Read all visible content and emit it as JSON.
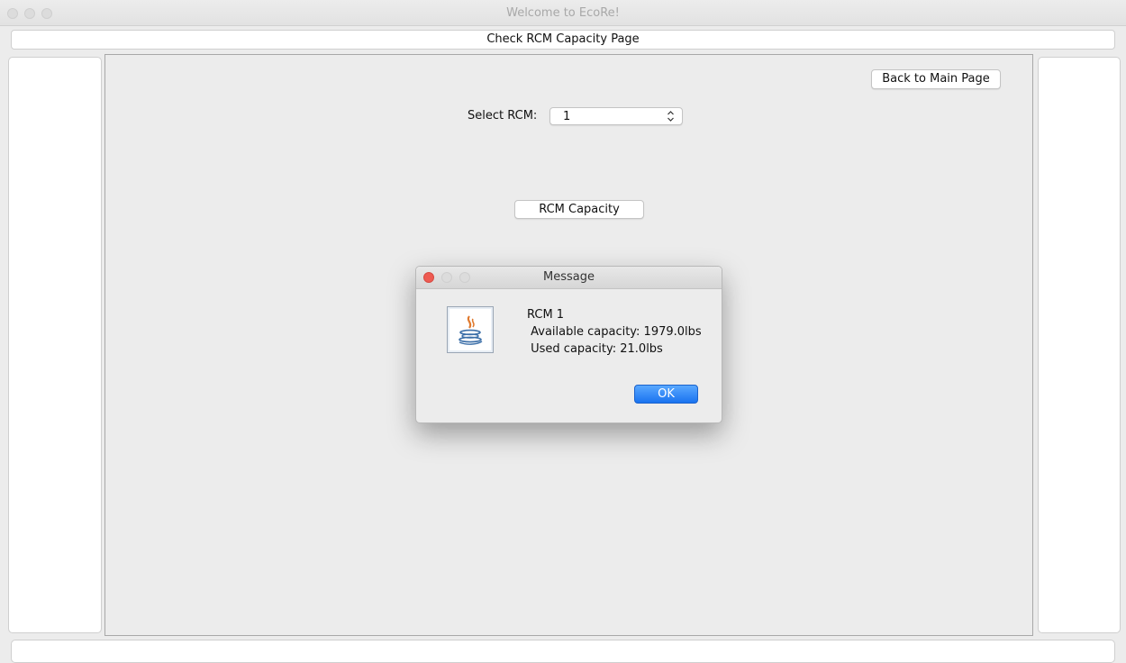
{
  "window": {
    "title": "Welcome to EcoRe!"
  },
  "page": {
    "title": "Check RCM Capacity Page"
  },
  "toolbar": {
    "back_label": "Back to Main Page"
  },
  "form": {
    "select_label": "Select RCM:",
    "select_value": "1",
    "capacity_button_label": "RCM Capacity"
  },
  "dialog": {
    "title": "Message",
    "icon": "java-icon",
    "lines": [
      "RCM 1",
      " Available capacity: 1979.0lbs",
      " Used capacity: 21.0lbs"
    ],
    "ok_label": "OK"
  },
  "colors": {
    "accent": "#1a73f0",
    "close": "#ee5b52"
  }
}
